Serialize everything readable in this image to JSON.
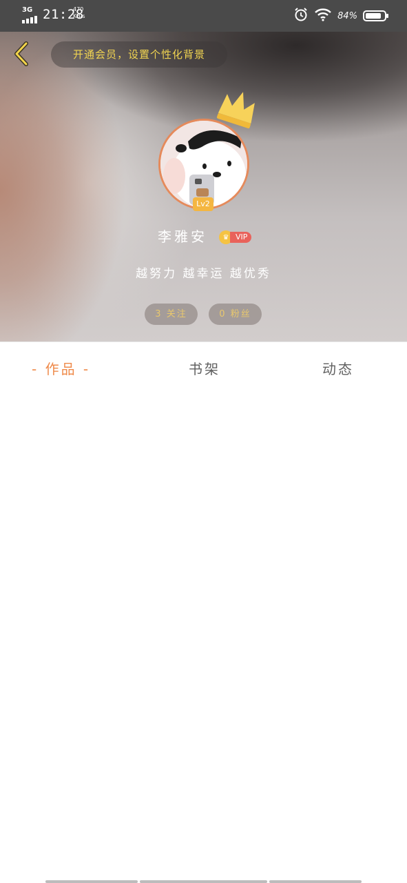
{
  "status_bar": {
    "network": "3G",
    "time": "21:28",
    "speed_value": "470",
    "speed_unit": "KB/s",
    "battery": "84%",
    "battery_level": 0.84
  },
  "header": {
    "promo_text": "开通会员，设置个性化背景"
  },
  "profile": {
    "level": "Lv2",
    "name": "李雅安",
    "vip_label": "VIP",
    "signature": "越努力 越幸运 越优秀",
    "following": "3 关注",
    "fans": "0 粉丝"
  },
  "tabs": {
    "works": "- 作品 -",
    "shelf": "书架",
    "feed": "动态"
  },
  "colors": {
    "accent": "#ef8a4a",
    "promo": "#f1d451",
    "vip": "#e9625b"
  }
}
